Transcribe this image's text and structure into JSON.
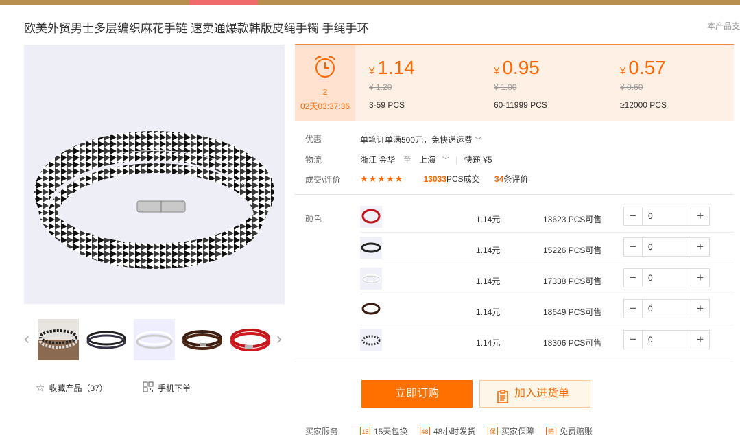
{
  "product": {
    "title": "欧美外贸男士多层编织麻花手链 速卖通爆款韩版皮绳手镯 手绳手环",
    "side_note": "本产品支"
  },
  "gallery": {
    "thumbnail_count": 5
  },
  "actions": {
    "favorite_label": "收藏产品（37）",
    "mobile_label": "手机下单"
  },
  "timer": {
    "days_num": "2",
    "countdown": "02天03:37:36"
  },
  "tiers": [
    {
      "currency": "¥",
      "price": "1.14",
      "original": "¥ 1.20",
      "range": "3-59  PCS"
    },
    {
      "currency": "¥",
      "price": "0.95",
      "original": "¥ 1.00",
      "range": "60-11999  PCS"
    },
    {
      "currency": "¥",
      "price": "0.57",
      "original": "¥ 0.60",
      "range": "≥12000  PCS"
    }
  ],
  "promo": {
    "label": "优惠",
    "value": "单笔订单满500元，免快递运费"
  },
  "logistics": {
    "label": "物流",
    "from": "浙江  金华",
    "to_word": "至",
    "to": "上海",
    "shipping": "快递 ¥5"
  },
  "trade": {
    "label": "成交\\评价",
    "stars": "★★★★★",
    "deal_count": "13033",
    "deal_suffix": "PCS成交",
    "review_count": "34",
    "review_suffix": "条评价"
  },
  "variants": {
    "label": "颜色",
    "rows": [
      {
        "color": "red",
        "price": "1.14元",
        "stock": "13623 PCS可售",
        "qty": "0"
      },
      {
        "color": "black",
        "price": "1.14元",
        "stock": "15226 PCS可售",
        "qty": "0"
      },
      {
        "color": "white",
        "price": "1.14元",
        "stock": "17338 PCS可售",
        "qty": "0"
      },
      {
        "color": "brown",
        "price": "1.14元",
        "stock": "18649 PCS可售",
        "qty": "0"
      },
      {
        "color": "black-white",
        "price": "1.14元",
        "stock": "18306 PCS可售",
        "qty": "0"
      }
    ]
  },
  "buttons": {
    "order": "立即订购",
    "cart": "加入进货单"
  },
  "services": {
    "label": "买家服务",
    "items": [
      {
        "icon": "15",
        "text": "15天包换"
      },
      {
        "icon": "48",
        "text": "48小时发货"
      },
      {
        "icon": "保",
        "text": "买家保障"
      },
      {
        "icon": "赔",
        "text": "免费赔账"
      }
    ]
  },
  "colors": {
    "accent": "#ff7000",
    "price_orange": "#ff6600",
    "topbar": "#b88f4e"
  }
}
